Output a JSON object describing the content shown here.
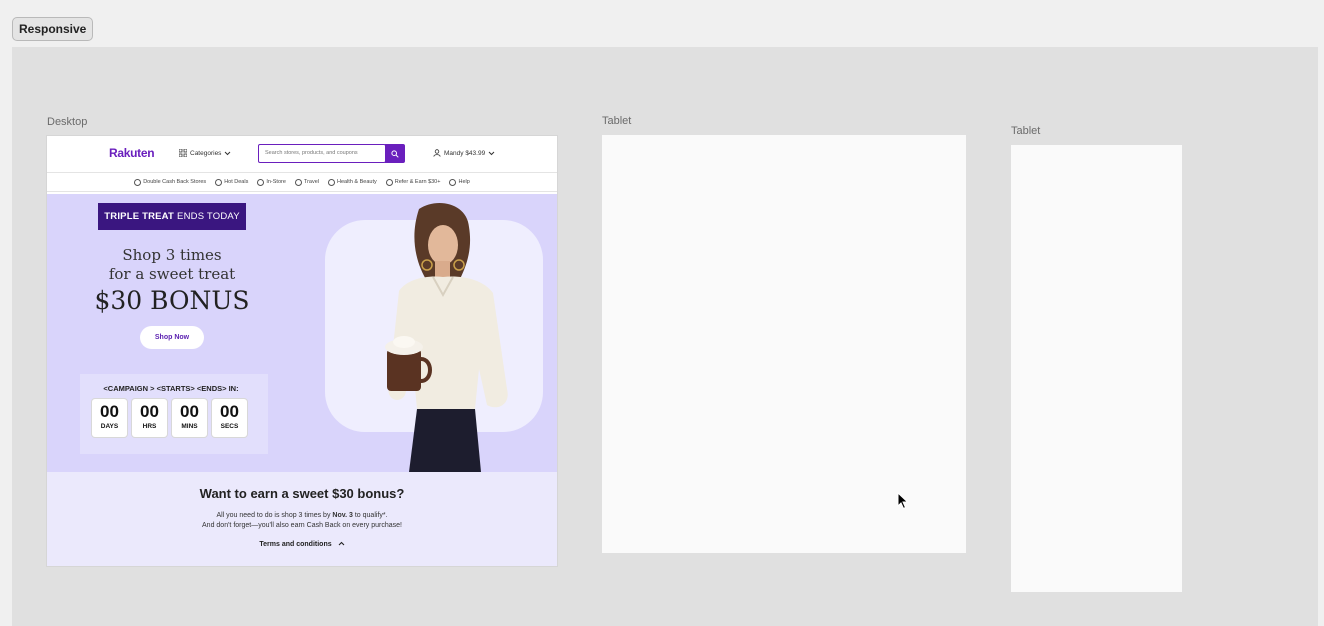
{
  "toolbar": {
    "responsive_label": "Responsive"
  },
  "frames": {
    "desktop_label": "Desktop",
    "tablet_label": "Tablet",
    "tablet2_label": "Tablet"
  },
  "site": {
    "logo": "Rakuten",
    "categories": "Categories",
    "search_placeholder": "Search stores, products, and coupons",
    "account": "Mandy $43.99",
    "nav": [
      "Double Cash Back Stores",
      "Hot Deals",
      "In-Store",
      "Travel",
      "Health & Beauty",
      "Refer & Earn $30+",
      "Help"
    ]
  },
  "hero": {
    "badge_bold": "TRIPLE TREAT",
    "badge_rest": "ENDS TODAY",
    "line1": "Shop 3 times",
    "line2": "for a sweet treat",
    "bonus": "$30 BONUS",
    "cta": "Shop Now",
    "countdown_title": "<CAMPAIGN > <STARTS> <ENDS> IN:",
    "countdown": [
      {
        "num": "00",
        "unit": "DAYS"
      },
      {
        "num": "00",
        "unit": "HRS"
      },
      {
        "num": "00",
        "unit": "MINS"
      },
      {
        "num": "00",
        "unit": "SECS"
      }
    ]
  },
  "info": {
    "heading": "Want to earn a sweet $30 bonus?",
    "p1_a": "All you need to do is shop 3 times by ",
    "p1_b": "Nov. 3",
    "p1_c": " to qualify*.",
    "p2": "And don't forget—you'll also earn Cash Back on every purchase!",
    "terms": "Terms and conditions"
  },
  "colors": {
    "brand": "#6a1fbd",
    "hero_bg": "#d9d4fb",
    "badge_bg": "#3a1680",
    "info_bg": "#ebe9fc"
  }
}
